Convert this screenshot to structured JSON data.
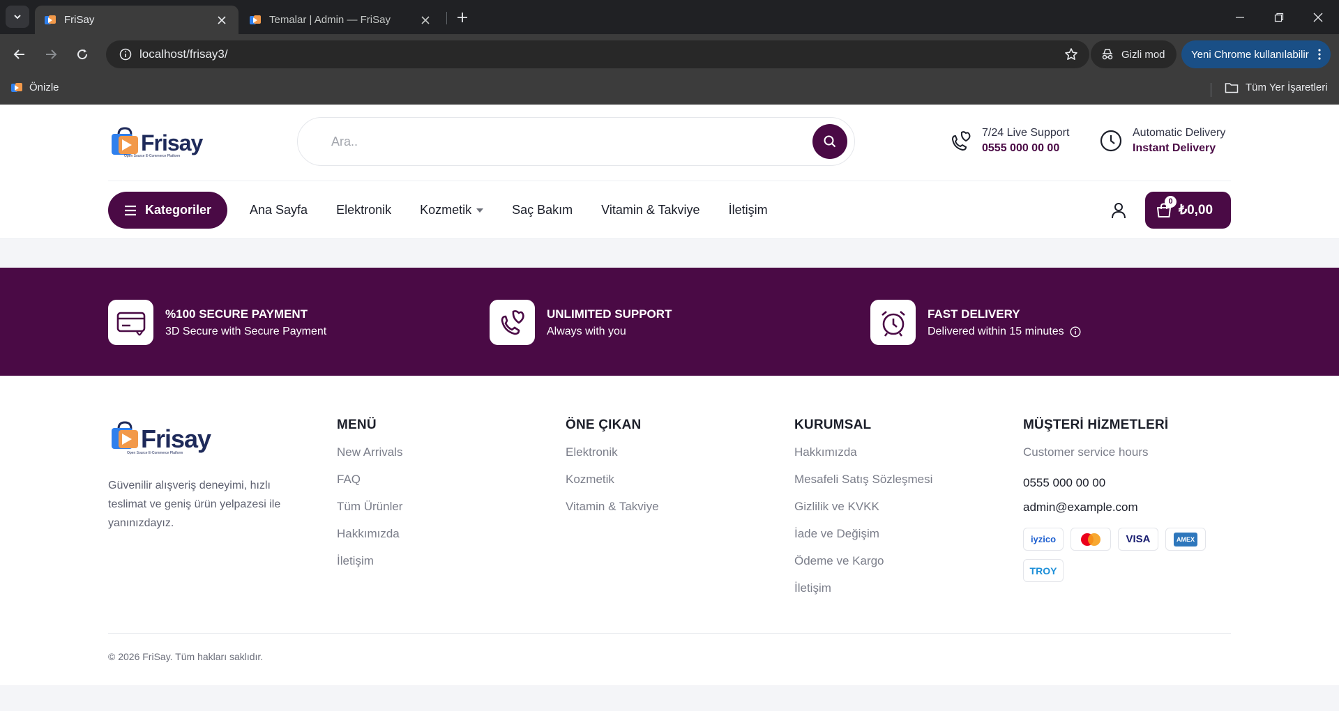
{
  "browser": {
    "tabs": [
      {
        "title": "FriSay",
        "active": true
      },
      {
        "title": "Temalar | Admin — FriSay",
        "active": false
      }
    ],
    "url": "localhost/frisay3/",
    "incognito_label": "Gizli mod",
    "update_label": "Yeni Chrome kullanılabilir",
    "bookmarks": [
      {
        "label": "Önizle"
      }
    ],
    "all_bookmarks_label": "Tüm Yer İşaretleri"
  },
  "header": {
    "logo_text": "Frisay",
    "logo_tagline": "Open Source E-Commerce Platform",
    "search_placeholder": "Ara..",
    "support": {
      "line1": "7/24 Live Support",
      "line2": "0555 000 00 00"
    },
    "delivery": {
      "line1": "Automatic Delivery",
      "line2": "Instant Delivery"
    },
    "categories_label": "Kategoriler",
    "nav": [
      {
        "label": "Ana Sayfa"
      },
      {
        "label": "Elektronik"
      },
      {
        "label": "Kozmetik",
        "dropdown": true
      },
      {
        "label": "Saç Bakım"
      },
      {
        "label": "Vitamin & Takviye"
      },
      {
        "label": "İletişim"
      }
    ],
    "cart": {
      "count": "0",
      "total": "₺0,00"
    }
  },
  "features": [
    {
      "title": "%100 SECURE PAYMENT",
      "subtitle": "3D Secure with Secure Payment",
      "icon": "credit-card-icon"
    },
    {
      "title": "UNLIMITED SUPPORT",
      "subtitle": "Always with you",
      "icon": "support-hands-icon"
    },
    {
      "title": "FAST DELIVERY",
      "subtitle": "Delivered within 15 minutes",
      "icon": "alarm-clock-icon"
    }
  ],
  "footer": {
    "logo_text": "Frisay",
    "logo_tagline": "Open Source E-Commerce Platform",
    "about": "Güvenilir alışveriş deneyimi, hızlı teslimat ve geniş ürün yelpazesi ile yanınızdayız.",
    "menu": {
      "title": "MENÜ",
      "links": [
        "New Arrivals",
        "FAQ",
        "Tüm Ürünler",
        "Hakkımızda",
        "İletişim"
      ]
    },
    "featured": {
      "title": "ÖNE ÇIKAN",
      "links": [
        "Elektronik",
        "Kozmetik",
        "Vitamin & Takviye"
      ]
    },
    "corporate": {
      "title": "KURUMSAL",
      "links": [
        "Hakkımızda",
        "Mesafeli Satış Sözleşmesi",
        "Gizlilik ve KVKK",
        "İade ve Değişim",
        "Ödeme ve Kargo",
        "İletişim"
      ]
    },
    "customer": {
      "title": "MÜŞTERİ HİZMETLERİ",
      "hours_label": "Customer service hours",
      "phone": "0555 000 00 00",
      "email": "admin@example.com"
    },
    "payments": [
      "iyzico",
      "",
      "VISA",
      "AMEX",
      "TROY"
    ],
    "copyright": "© 2026 FriSay. Tüm hakları saklıdır."
  },
  "colors": {
    "brand": "#4a0a45",
    "navy": "#1e2a5a",
    "orange": "#f2994a",
    "blue": "#2f80ed"
  }
}
